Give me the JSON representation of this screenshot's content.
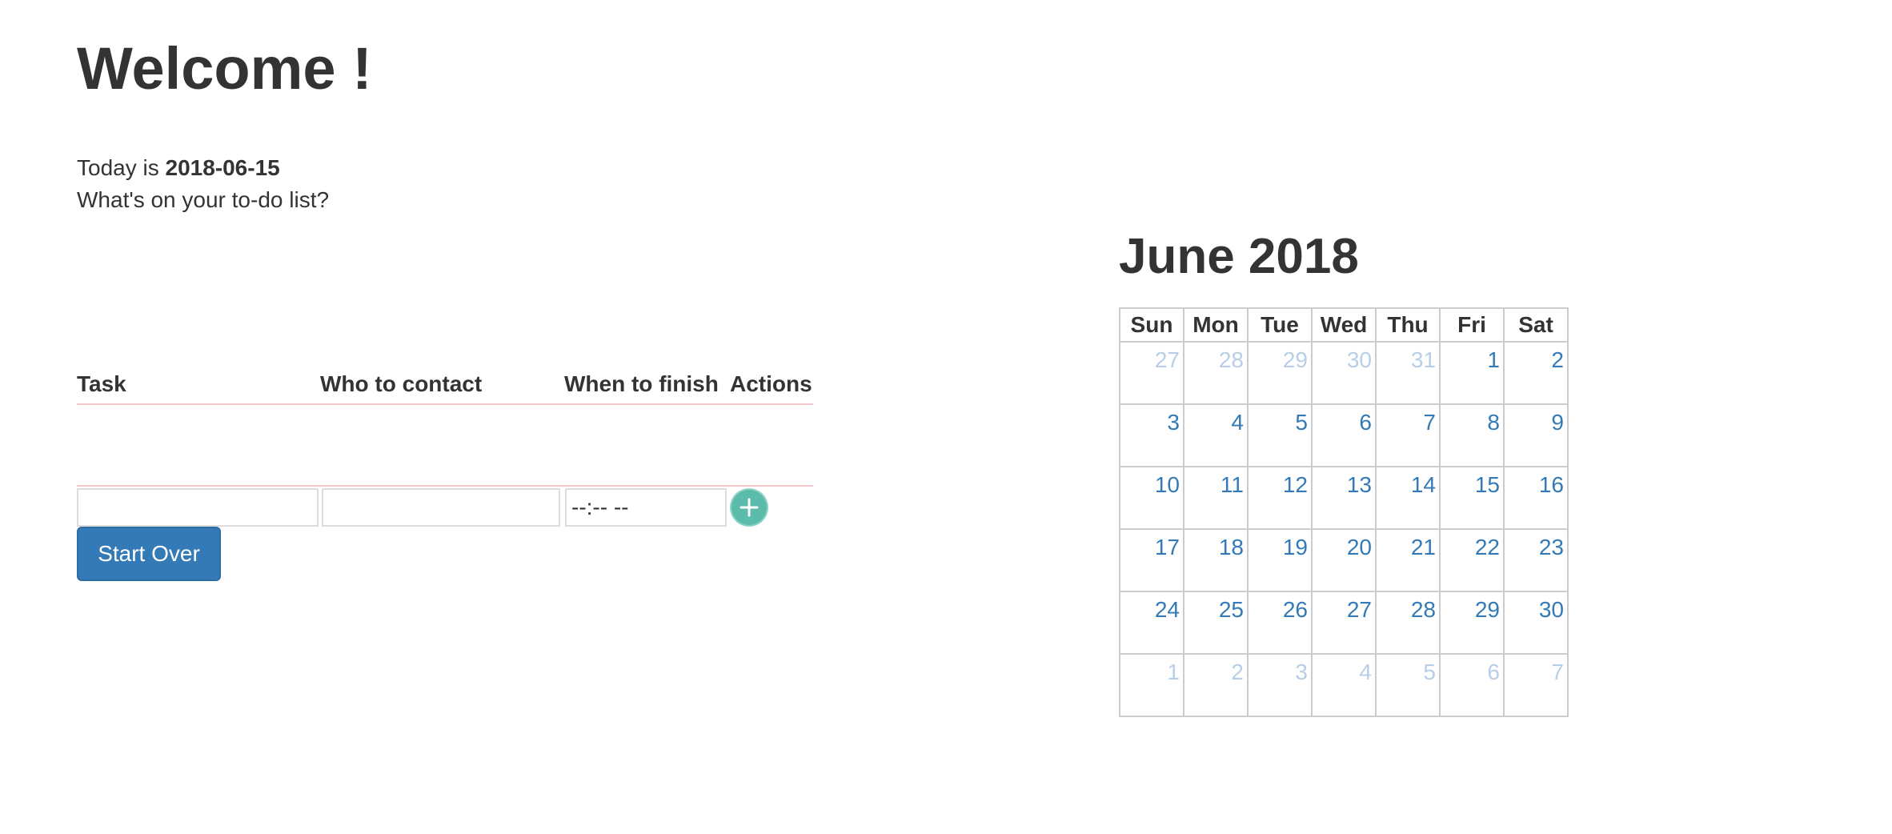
{
  "header": {
    "welcome": "Welcome !",
    "today_prefix": "Today is ",
    "today_date": "2018-06-15",
    "prompt": "What's on your to-do list?"
  },
  "todo": {
    "columns": {
      "task": "Task",
      "who": "Who to contact",
      "when": "When to finish",
      "actions": "Actions"
    },
    "inputs": {
      "task_value": "",
      "who_value": "",
      "when_value": "--:-- --"
    },
    "add_icon": "plus-circle-icon",
    "start_over_label": "Start Over"
  },
  "calendar": {
    "title": "June 2018",
    "weekdays": [
      "Sun",
      "Mon",
      "Tue",
      "Wed",
      "Thu",
      "Fri",
      "Sat"
    ],
    "weeks": [
      [
        {
          "d": "27",
          "other": true
        },
        {
          "d": "28",
          "other": true
        },
        {
          "d": "29",
          "other": true
        },
        {
          "d": "30",
          "other": true
        },
        {
          "d": "31",
          "other": true
        },
        {
          "d": "1",
          "other": false
        },
        {
          "d": "2",
          "other": false
        }
      ],
      [
        {
          "d": "3",
          "other": false
        },
        {
          "d": "4",
          "other": false
        },
        {
          "d": "5",
          "other": false
        },
        {
          "d": "6",
          "other": false
        },
        {
          "d": "7",
          "other": false
        },
        {
          "d": "8",
          "other": false
        },
        {
          "d": "9",
          "other": false
        }
      ],
      [
        {
          "d": "10",
          "other": false
        },
        {
          "d": "11",
          "other": false
        },
        {
          "d": "12",
          "other": false
        },
        {
          "d": "13",
          "other": false
        },
        {
          "d": "14",
          "other": false
        },
        {
          "d": "15",
          "other": false
        },
        {
          "d": "16",
          "other": false
        }
      ],
      [
        {
          "d": "17",
          "other": false
        },
        {
          "d": "18",
          "other": false
        },
        {
          "d": "19",
          "other": false
        },
        {
          "d": "20",
          "other": false
        },
        {
          "d": "21",
          "other": false
        },
        {
          "d": "22",
          "other": false
        },
        {
          "d": "23",
          "other": false
        }
      ],
      [
        {
          "d": "24",
          "other": false
        },
        {
          "d": "25",
          "other": false
        },
        {
          "d": "26",
          "other": false
        },
        {
          "d": "27",
          "other": false
        },
        {
          "d": "28",
          "other": false
        },
        {
          "d": "29",
          "other": false
        },
        {
          "d": "30",
          "other": false
        }
      ],
      [
        {
          "d": "1",
          "other": true
        },
        {
          "d": "2",
          "other": true
        },
        {
          "d": "3",
          "other": true
        },
        {
          "d": "4",
          "other": true
        },
        {
          "d": "5",
          "other": true
        },
        {
          "d": "6",
          "other": true
        },
        {
          "d": "7",
          "other": true
        }
      ]
    ],
    "colors": {
      "current_month": "#337ab7",
      "other_month": "#b7cfe6"
    }
  },
  "colors": {
    "text": "#333333",
    "button_primary": "#337ab7",
    "add_button": "#5bbcab",
    "table_rule": "#f2c6cc"
  }
}
